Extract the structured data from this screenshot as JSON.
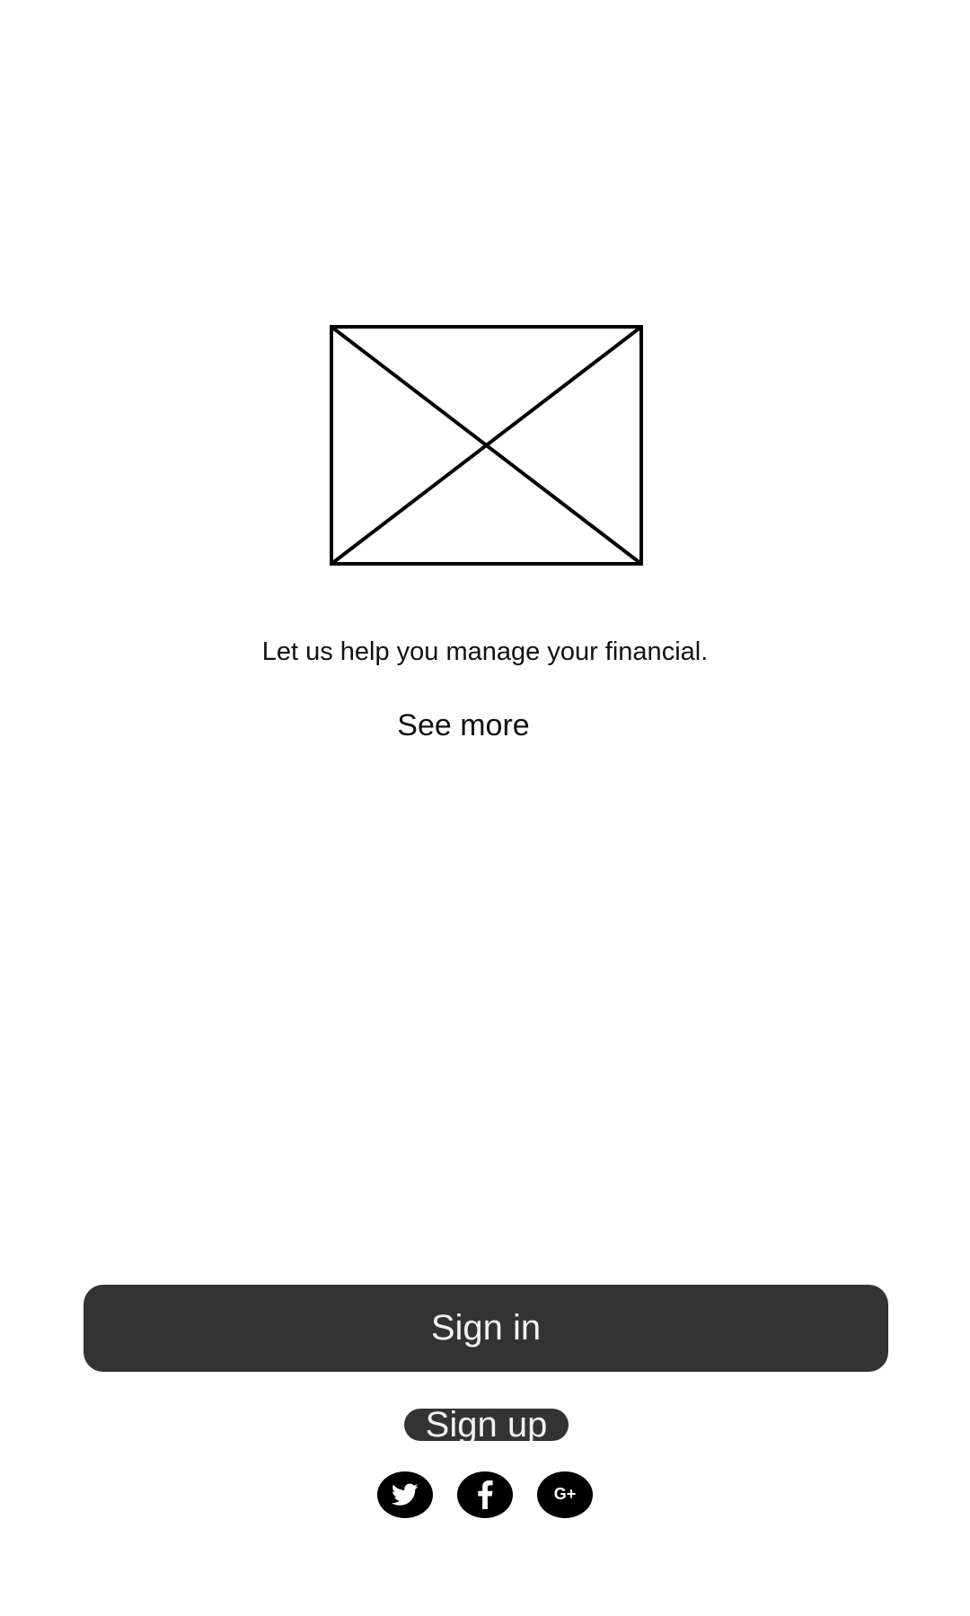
{
  "hero": {
    "image_icon": "image-placeholder-icon"
  },
  "content": {
    "tagline": "Let us help you manage your financial.",
    "see_more_label": "See more"
  },
  "actions": {
    "sign_in_label": "Sign in",
    "sign_up_label": "Sign up"
  },
  "social": {
    "items": [
      {
        "icon": "twitter-icon",
        "color": "#000000"
      },
      {
        "icon": "facebook-icon",
        "color": "#000000"
      },
      {
        "icon": "google-plus-icon",
        "color": "#000000"
      }
    ],
    "google_plus_glyph": "G+"
  },
  "colors": {
    "background": "#ffffff",
    "button": "#333333",
    "button_text": "#f2f2f2",
    "text": "#111111"
  }
}
